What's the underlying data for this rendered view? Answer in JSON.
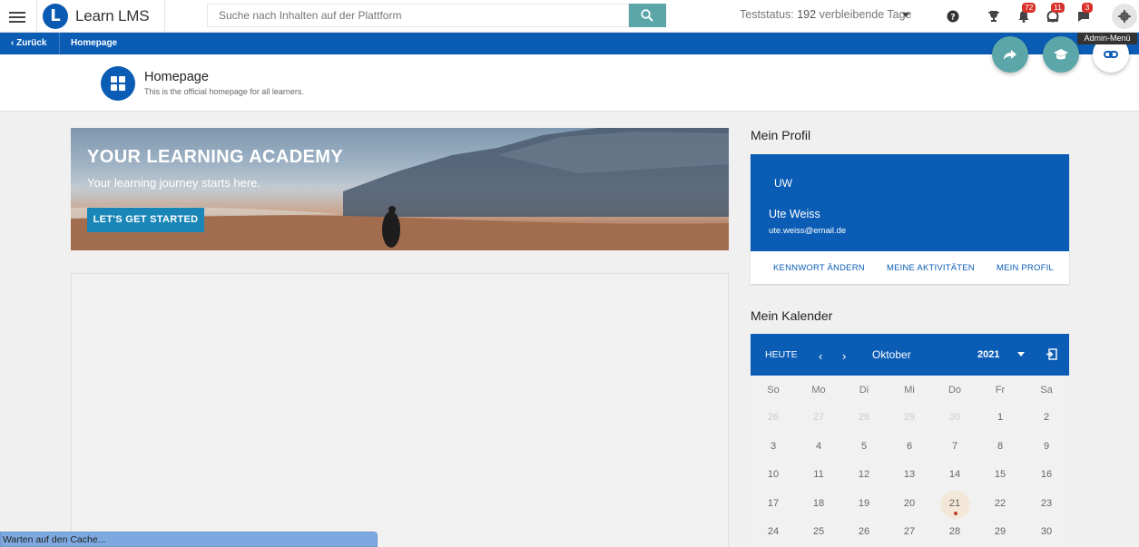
{
  "header": {
    "logo_letter": "L",
    "app_name": "Learn LMS",
    "search_placeholder": "Suche nach Inhalten auf der Plattform",
    "trial_label": "Teststatus:",
    "trial_days": "192",
    "trial_suffix": "verbleibende Tage",
    "badges": {
      "notifications": "72",
      "gamification": "11",
      "messages": "3"
    },
    "icons": [
      "menu-icon",
      "search-icon",
      "help-icon",
      "trophy-icon",
      "bell-icon",
      "badge-icon",
      "chat-icon",
      "gear-icon"
    ]
  },
  "nav": {
    "back_label": "Zurück",
    "breadcrumb": "Homepage",
    "tooltip": "Admin-Menü"
  },
  "page": {
    "title": "Homepage",
    "subtitle": "This is the official homepage for all learners."
  },
  "banner": {
    "title": "YOUR LEARNING ACADEMY",
    "subtitle": "Your learning journey starts here.",
    "button": "LET'S GET STARTED"
  },
  "profile": {
    "section_title": "Mein Profil",
    "initials": "UW",
    "name": "Ute Weiss",
    "email": "ute.weiss@email.de",
    "links": [
      "KENNWORT ÄNDERN",
      "MEINE AKTIVITÄTEN",
      "MEIN PROFIL"
    ]
  },
  "calendar": {
    "section_title": "Mein Kalender",
    "today_label": "HEUTE",
    "month": "Oktober",
    "year": "2021",
    "weekdays": [
      "So",
      "Mo",
      "Di",
      "Mi",
      "Do",
      "Fr",
      "Sa"
    ],
    "weeks": [
      [
        "26",
        "27",
        "28",
        "29",
        "30",
        "1",
        "2"
      ],
      [
        "3",
        "4",
        "5",
        "6",
        "7",
        "8",
        "9"
      ],
      [
        "10",
        "11",
        "12",
        "13",
        "14",
        "15",
        "16"
      ],
      [
        "17",
        "18",
        "19",
        "20",
        "21",
        "22",
        "23"
      ],
      [
        "24",
        "25",
        "26",
        "27",
        "28",
        "29",
        "30"
      ]
    ],
    "today": "21"
  },
  "status_bar": "Warten auf den Cache..."
}
